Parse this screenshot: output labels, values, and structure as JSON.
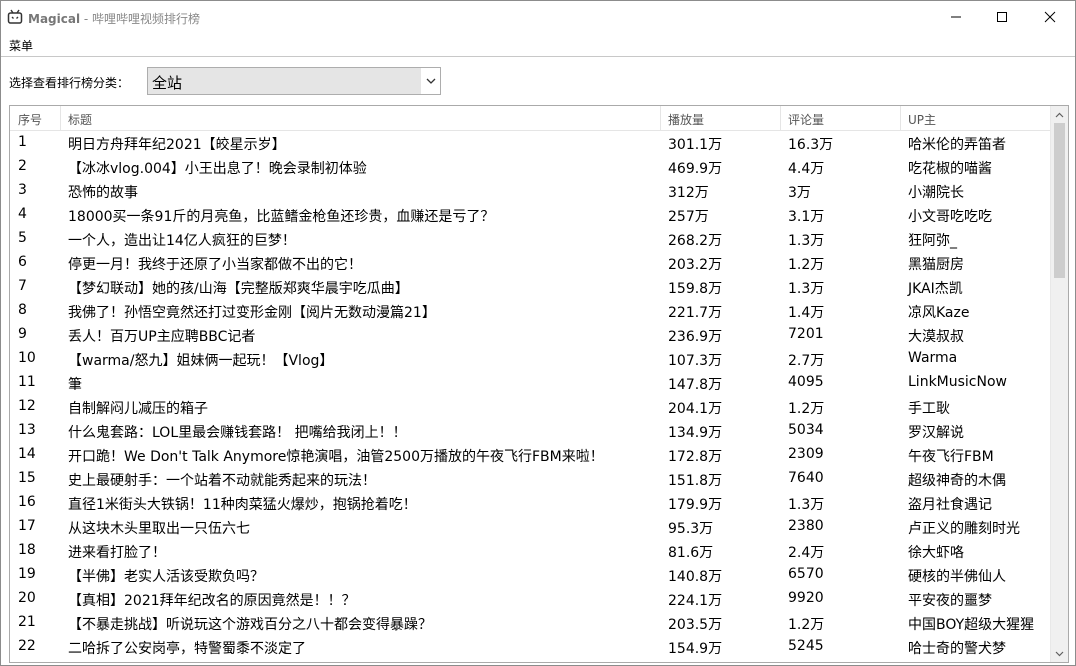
{
  "window": {
    "app_name": "Magical",
    "title": " - 哔哩哔哩视频排行榜"
  },
  "menu": {
    "label": "菜单"
  },
  "category": {
    "label": "选择查看排行榜分类：",
    "selected": "全站"
  },
  "table": {
    "headers": [
      "序号",
      "标题",
      "播放量",
      "评论量",
      "UP主"
    ],
    "rows": [
      [
        "1",
        "明日方舟拜年纪2021【皎星示岁】",
        "301.1万",
        "16.3万",
        "哈米伦的弄笛者"
      ],
      [
        "2",
        "【冰冰vlog.004】小王出息了！晚会录制初体验",
        "469.9万",
        "4.4万",
        "吃花椒的喵酱"
      ],
      [
        "3",
        "恐怖的故事",
        "312万",
        "3万",
        "小潮院长"
      ],
      [
        "4",
        "18000买一条91斤的月亮鱼，比蓝鳍金枪鱼还珍贵，血赚还是亏了？",
        "257万",
        "3.1万",
        "小文哥吃吃吃"
      ],
      [
        "5",
        "一个人，造出让14亿人疯狂的巨梦！",
        "268.2万",
        "1.3万",
        "狂阿弥_"
      ],
      [
        "6",
        "停更一月！我终于还原了小当家都做不出的它！",
        "203.2万",
        "1.2万",
        "黑猫厨房"
      ],
      [
        "7",
        "【梦幻联动】她的孩/山海【完整版郑爽华晨宇吃瓜曲】",
        "159.8万",
        "1.3万",
        "JKAI杰凯"
      ],
      [
        "8",
        "我佛了！孙悟空竟然还打过变形金刚【阅片无数动漫篇21】",
        "221.7万",
        "1.4万",
        "凉风Kaze"
      ],
      [
        "9",
        "丢人！百万UP主应聘BBC记者",
        "236.9万",
        "7201",
        "大漠叔叔"
      ],
      [
        "10",
        "【warma/怒九】姐妹俩一起玩！【Vlog】",
        "107.3万",
        "2.7万",
        "Warma"
      ],
      [
        "11",
        "筆",
        "147.8万",
        "4095",
        "LinkMusicNow"
      ],
      [
        "12",
        "自制解闷儿减压的箱子",
        "204.1万",
        "1.2万",
        "手工耿"
      ],
      [
        "13",
        "什么鬼套路：LOL里最会赚钱套路！ 把嘴给我闭上！！",
        "134.9万",
        "5034",
        "罗汉解说"
      ],
      [
        "14",
        "开口跪！We Don't Talk Anymore惊艳演唱，油管2500万播放的午夜飞行FBM来啦！",
        "172.8万",
        "2309",
        "午夜飞行FBM"
      ],
      [
        "15",
        "史上最硬射手：一个站着不动就能秀起来的玩法！",
        "151.8万",
        "7640",
        "超级神奇的木偶"
      ],
      [
        "16",
        "直径1米街头大铁锅！11种肉菜猛火爆炒，抱锅抢着吃！",
        "179.9万",
        "1.3万",
        "盗月社食遇记"
      ],
      [
        "17",
        "从这块木头里取出一只伍六七",
        "95.3万",
        "2380",
        "卢正义的雕刻时光"
      ],
      [
        "18",
        "进来看打脸了！",
        "81.6万",
        "2.4万",
        "徐大虾咯"
      ],
      [
        "19",
        "【半佛】老实人活该受欺负吗？",
        "140.8万",
        "6570",
        "硬核的半佛仙人"
      ],
      [
        "20",
        "【真相】2021拜年纪改名的原因竟然是！！？",
        "224.1万",
        "9920",
        "平安夜的噩梦"
      ],
      [
        "21",
        "【不暴走挑战】听说玩这个游戏百分之八十都会变得暴躁？",
        "203.5万",
        "1.2万",
        "中国BOY超级大猩猩"
      ],
      [
        "22",
        "二哈拆了公安岗亭，特警蜀黍不淡定了",
        "154.9万",
        "5245",
        "哈士奇的警犬梦"
      ]
    ]
  }
}
